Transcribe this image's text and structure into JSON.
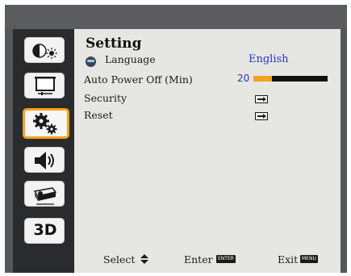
{
  "menu": {
    "title": "Setting",
    "items": [
      {
        "label": "Language",
        "value": "English"
      },
      {
        "label": "Auto Power Off (Min)",
        "value": "20",
        "level": 0.25
      },
      {
        "label": "Security"
      },
      {
        "label": "Reset"
      }
    ]
  },
  "sidebar": {
    "icons": [
      "picture-mode-icon",
      "screen-icon",
      "settings-gears-icon",
      "audio-icon",
      "projector-icon",
      "3d-icon"
    ],
    "three_d_label": "3D",
    "active": "settings-gears-icon"
  },
  "footer": {
    "select_label": "Select",
    "enter_label": "Enter",
    "enter_key": "ENTER",
    "exit_label": "Exit",
    "exit_key": "MENU"
  },
  "colors": {
    "accent": "#f6a21a",
    "value_text": "#2a34c8",
    "panel": "#e6e6e2",
    "sidebar": "#2a2b2d"
  }
}
